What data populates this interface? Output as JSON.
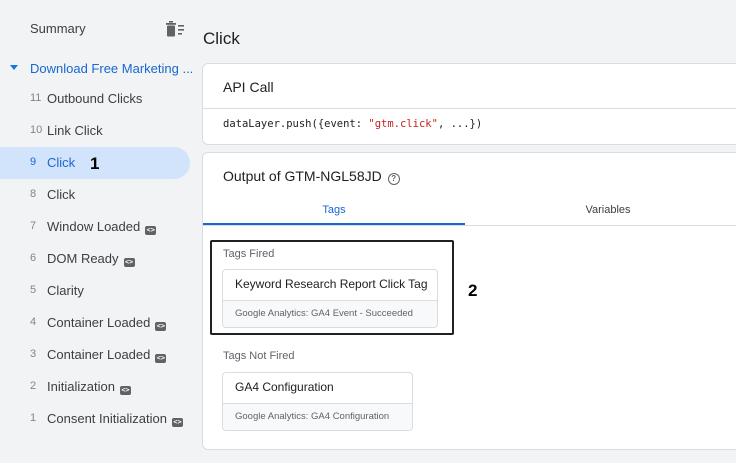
{
  "sidebar": {
    "summary_label": "Summary",
    "container_label": "Download Free Marketing ...",
    "events": [
      {
        "num": "11",
        "name": "Outbound Clicks",
        "code": false,
        "selected": false
      },
      {
        "num": "10",
        "name": "Link Click",
        "code": false,
        "selected": false
      },
      {
        "num": "9",
        "name": "Click",
        "code": false,
        "selected": true
      },
      {
        "num": "8",
        "name": "Click",
        "code": false,
        "selected": false
      },
      {
        "num": "7",
        "name": "Window Loaded",
        "code": true,
        "selected": false
      },
      {
        "num": "6",
        "name": "DOM Ready",
        "code": true,
        "selected": false
      },
      {
        "num": "5",
        "name": "Clarity",
        "code": false,
        "selected": false
      },
      {
        "num": "4",
        "name": "Container Loaded",
        "code": true,
        "selected": false
      },
      {
        "num": "3",
        "name": "Container Loaded",
        "code": true,
        "selected": false
      },
      {
        "num": "2",
        "name": "Initialization",
        "code": true,
        "selected": false
      },
      {
        "num": "1",
        "name": "Consent Initialization",
        "code": true,
        "selected": false
      }
    ]
  },
  "markers": {
    "one": "1",
    "two": "2"
  },
  "main": {
    "title": "Click",
    "api": {
      "title": "API Call",
      "code_prefix": "dataLayer.push({event: ",
      "code_string": "\"gtm.click\"",
      "code_suffix": ", ...})"
    },
    "output": {
      "title": "Output of GTM-NGL58JD",
      "help_glyph": "?",
      "tabs": [
        "Tags",
        "Variables"
      ],
      "tags_fired_label": "Tags Fired",
      "tags_fired": [
        {
          "name": "Keyword Research Report Click Tag",
          "sub": "Google Analytics: GA4 Event - Succeeded"
        }
      ],
      "tags_not_fired_label": "Tags Not Fired",
      "tags_not_fired": [
        {
          "name": "GA4 Configuration",
          "sub": "Google Analytics: GA4 Configuration"
        }
      ]
    }
  },
  "colors": {
    "accent": "#1967d2",
    "selected_bg": "#d2e3fc"
  },
  "icons": {
    "trash": "trash-icon",
    "code": "code-icon",
    "help": "help-icon",
    "caret": "caret-down-icon"
  }
}
